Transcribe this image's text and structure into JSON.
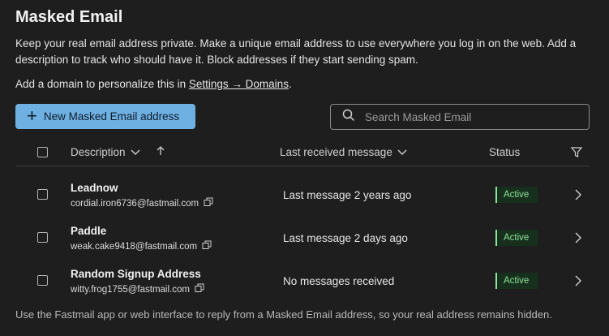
{
  "page": {
    "title": "Masked Email",
    "description": "Keep your real email address private. Make a unique email address to use everywhere you log in on the web. Add a description to track who should have it. Block addresses if they start sending spam.",
    "domain_prefix": "Add a domain to personalize this in ",
    "domain_link": "Settings → Domains",
    "domain_suffix": "."
  },
  "toolbar": {
    "new_button_label": "New Masked Email address",
    "search_placeholder": "Search Masked Email"
  },
  "table": {
    "headers": {
      "description": "Description",
      "last_received": "Last received message",
      "status": "Status"
    },
    "rows": [
      {
        "name": "Leadnow",
        "email": "cordial.iron6736@fastmail.com",
        "last_message": "Last message 2 years ago",
        "status": "Active"
      },
      {
        "name": "Paddle",
        "email": "weak.cake9418@fastmail.com",
        "last_message": "Last message 2 days ago",
        "status": "Active"
      },
      {
        "name": "Random Signup Address",
        "email": "witty.frog1755@fastmail.com",
        "last_message": "No messages received",
        "status": "Active"
      }
    ]
  },
  "footer": {
    "text": "Use the Fastmail app or web interface to reply from a Masked Email address, so your real address remains hidden."
  },
  "colors": {
    "background": "#1e1e1f",
    "accent_button": "#6fb0e3",
    "active_badge_text": "#8fe29a",
    "active_badge_bg": "#16301d"
  }
}
